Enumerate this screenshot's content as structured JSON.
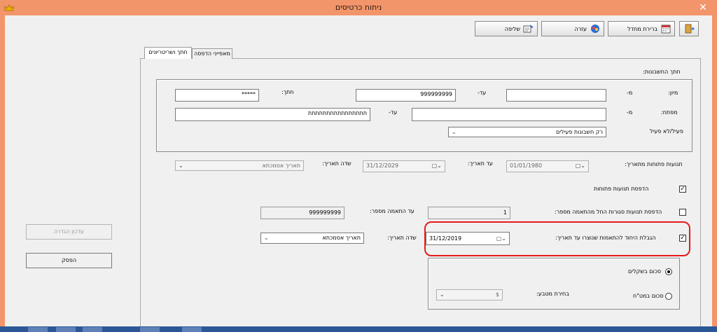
{
  "window": {
    "title": "ניתוח כרטיסים",
    "close_glyph": "✕"
  },
  "toolbar": {
    "buttons": [
      {
        "label": "שליפה",
        "icon": "retrieve-icon"
      },
      {
        "label": "עזרה",
        "icon": "help-icon"
      },
      {
        "label": "ברירת מחדל",
        "icon": "calendar-icon"
      },
      {
        "label": "",
        "icon": "exit-door-icon"
      }
    ]
  },
  "tabs": [
    {
      "label": "חתך ושריטריונים",
      "active": true
    },
    {
      "label": "מאפייני הדפסה",
      "active": false
    }
  ],
  "accounts_section": {
    "title": "חתך החשבונות:",
    "sort_label": "מיון:",
    "from_label": "מ-",
    "to_label": "עד-",
    "sort_from": "",
    "sort_to": "999999999",
    "cut_label": "חתך:",
    "cut_value": "*****",
    "key_label": "מפתח:",
    "key_from": "",
    "key_to": "תתתתתתתתתתתתתתתת",
    "active_label": "פעיל/לא פעיל",
    "active_value": "רק חשבונות פעילים"
  },
  "open_movements": {
    "from_date_label": "תנועות פתוחות מתאריך:",
    "from_date": "01/01/1980",
    "to_date_label": "עד תאריך:",
    "to_date": "31/12/2029",
    "date_field_label": "שדה תאריך:",
    "date_field_value": "תאריך אסמכתא"
  },
  "print_open_movements": {
    "label": "הדפסת תנועות פתוחות",
    "checked": true
  },
  "closed_matches": {
    "label": "הדפסת תנועות סגורות החל מהתאמה מספר:",
    "checked": false,
    "from_value": "1",
    "to_label": "עד התאמה מספר:",
    "to_value": "999999999"
  },
  "limit_matches": {
    "label": "הגבלת היחוד להתאמות שנוצרו עד תאריך:",
    "checked": true,
    "date": "31/12/2019",
    "date_field_label": "שדה תאריך:",
    "date_field_value": "תאריך אסמכתא"
  },
  "currency_section": {
    "sum_shekel_label": "סכום בשקלים",
    "sum_foreign_label": "סכום במט\"ח",
    "selected": "shekel",
    "currency_label": "בחירת מטבע:",
    "currency_value": "$"
  },
  "left_buttons": {
    "update_label": "עדכון הגדרה",
    "stop_label": "הפסק"
  },
  "colors": {
    "titlebar": "#f2956a",
    "highlight": "#e41b1b",
    "taskbar": "#2b5797"
  }
}
